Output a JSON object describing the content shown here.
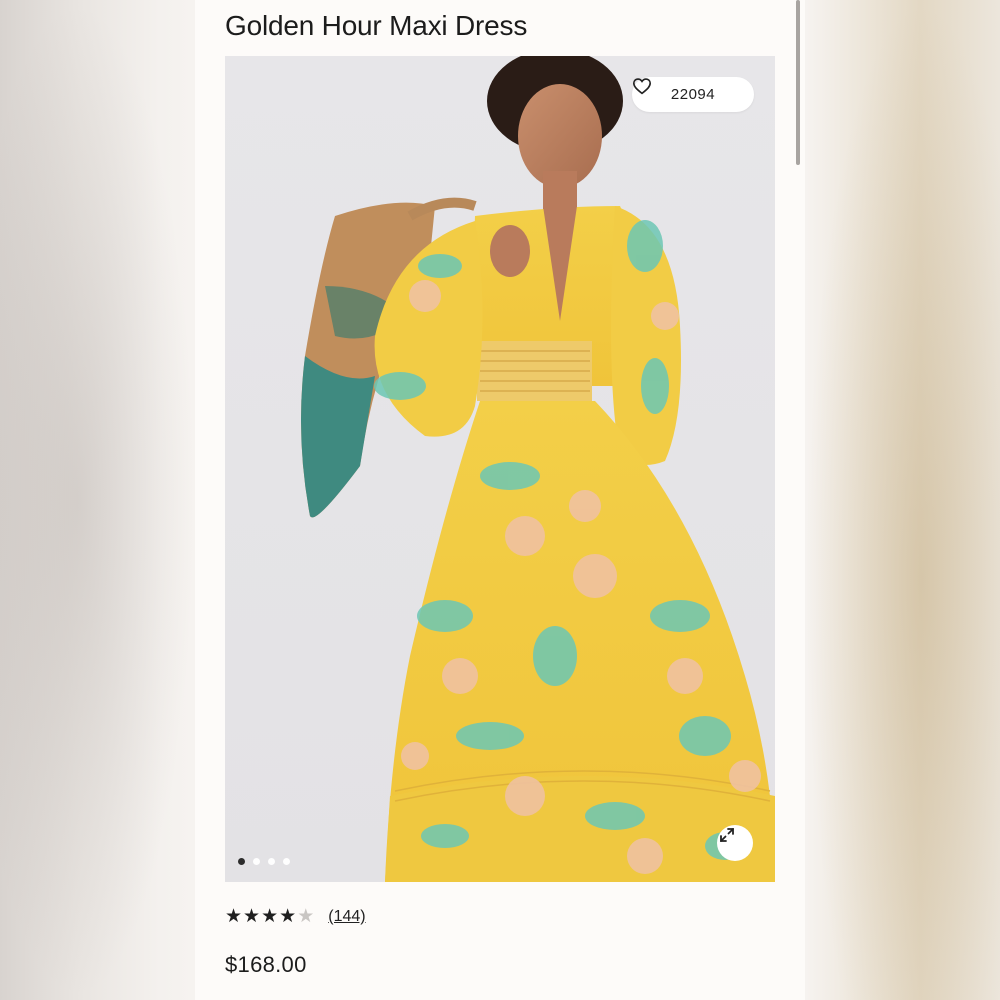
{
  "product": {
    "title": "Golden Hour Maxi Dress",
    "favorites_count": "22094",
    "price": "$168.00",
    "rating": {
      "stars_filled": 4,
      "stars_total": 5,
      "review_count": "(144)"
    }
  },
  "gallery": {
    "image_count": 4,
    "active_index": 0
  },
  "icons": {
    "favorite": "heart-outline-icon",
    "expand": "expand-arrows-icon",
    "star_full": "★",
    "star_empty": "★"
  },
  "colors": {
    "dress_yellow": "#f2c63a",
    "dress_teal": "#6cc7b4",
    "dress_peach": "#f0c2a0",
    "bag_teal": "#3f8a80",
    "bag_tan": "#c08e5c",
    "photo_background": "#e5e4e7"
  }
}
